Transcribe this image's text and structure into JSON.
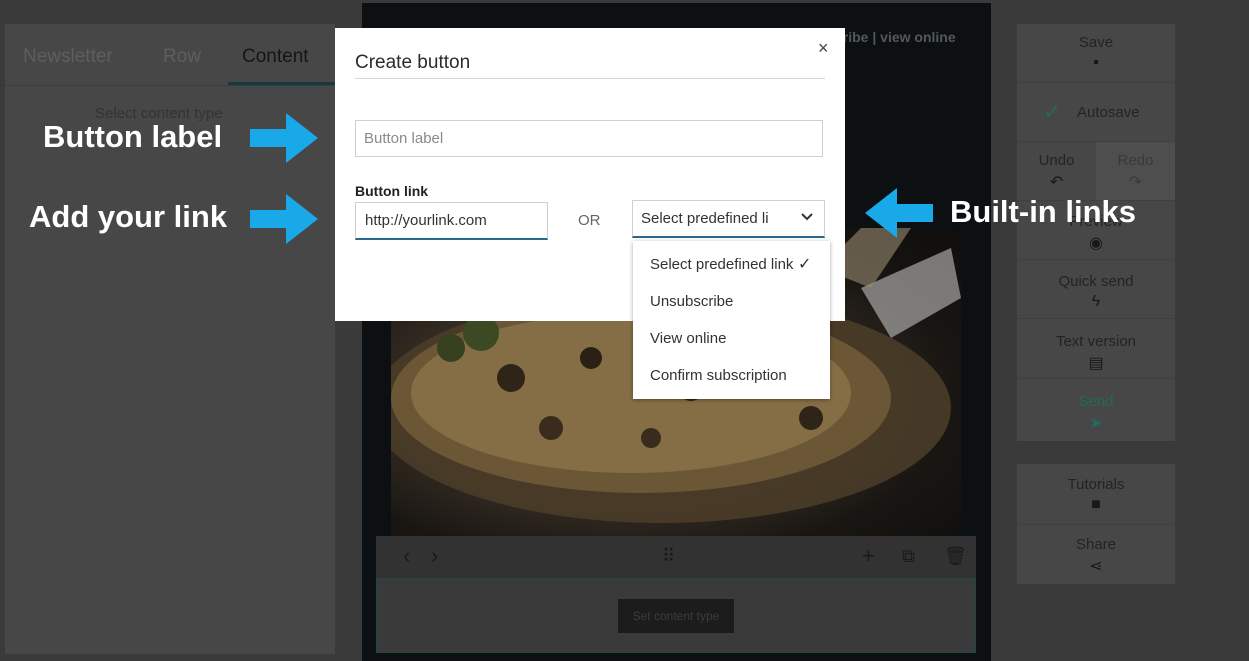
{
  "left_panel": {
    "tabs": [
      {
        "label": "Newsletter"
      },
      {
        "label": "Row"
      },
      {
        "label": "Content"
      }
    ],
    "select_content_type": "Select content type"
  },
  "editor": {
    "header_links": "cribe | view online",
    "set_content_type": "Set content type"
  },
  "right_panel": {
    "save": "Save",
    "autosave": "Autosave",
    "undo": "Undo",
    "redo": "Redo",
    "preview": "Preview",
    "quick_send": "Quick send",
    "text_version": "Text version",
    "send": "Send",
    "tutorials": "Tutorials",
    "share": "Share"
  },
  "modal": {
    "title": "Create button",
    "close": "×",
    "button_label_placeholder": "Button label",
    "link_caption": "Button link",
    "link_value": "http://yourlink.com",
    "or": "OR",
    "predefined_selected": "Select predefined li"
  },
  "dropdown": {
    "options": [
      {
        "label": "Select predefined link",
        "selected": true
      },
      {
        "label": "Unsubscribe"
      },
      {
        "label": "View online"
      },
      {
        "label": "Confirm subscription"
      }
    ],
    "check": "✓"
  },
  "annotations": {
    "button_label": "Button label",
    "add_link": "Add your link",
    "builtin_links": "Built-in links"
  },
  "colors": {
    "annotation_arrow": "#19a9e8",
    "send_accent": "#1f6b5c",
    "input_underline": "#2a6a8a"
  }
}
